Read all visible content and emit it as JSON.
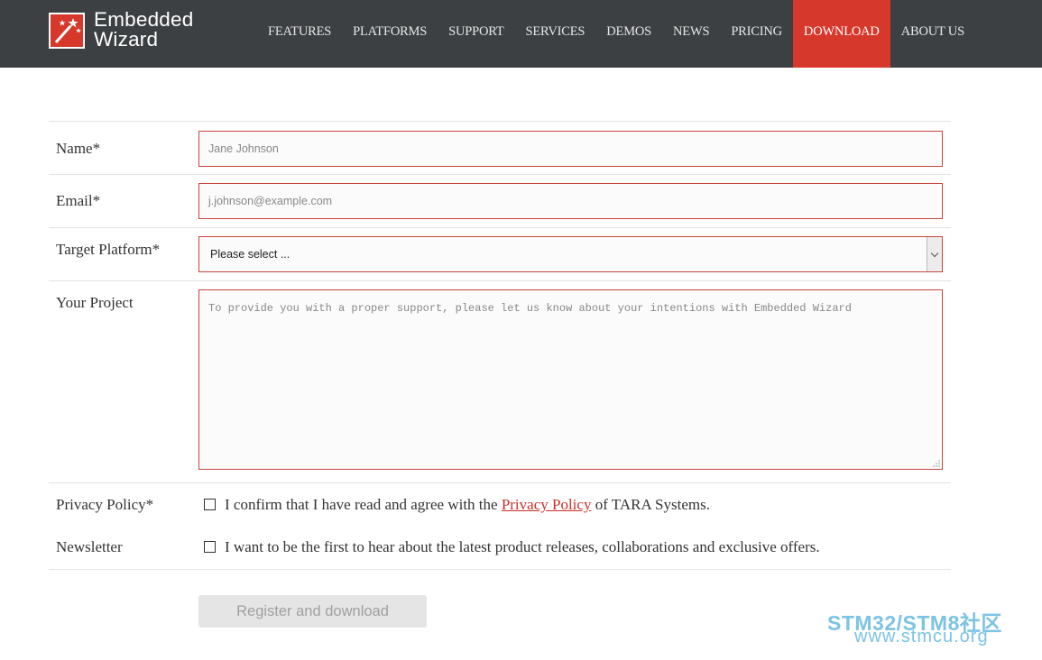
{
  "brand": {
    "line1": "Embedded",
    "line2": "Wizard",
    "accent": "#d7382c",
    "header_bg": "#3d4043"
  },
  "nav": [
    {
      "label": "FEATURES"
    },
    {
      "label": "PLATFORMS"
    },
    {
      "label": "SUPPORT"
    },
    {
      "label": "SERVICES"
    },
    {
      "label": "DEMOS"
    },
    {
      "label": "NEWS"
    },
    {
      "label": "PRICING"
    },
    {
      "label": "DOWNLOAD",
      "active": true
    },
    {
      "label": "ABOUT US"
    }
  ],
  "form": {
    "name": {
      "label": "Name*",
      "placeholder": "Jane Johnson"
    },
    "email": {
      "label": "Email*",
      "placeholder": "j.johnson@example.com"
    },
    "platform": {
      "label": "Target Platform*",
      "selected": "Please select ..."
    },
    "project": {
      "label": "Your Project",
      "placeholder": "To provide you with a proper support, please let us know about your intentions with Embedded Wizard"
    },
    "privacy": {
      "label": "Privacy Policy*",
      "text_before": "I confirm that I have read and agree with the ",
      "link": "Privacy Policy",
      "text_after": " of TARA Systems."
    },
    "newsletter": {
      "label": "Newsletter",
      "text": "I want to be the first to hear about the latest product releases, collaborations and exclusive offers."
    },
    "submit_label": "Register and download"
  },
  "watermark": {
    "line1": "STM32/STM8社区",
    "line2": "www.stmcu.org"
  }
}
